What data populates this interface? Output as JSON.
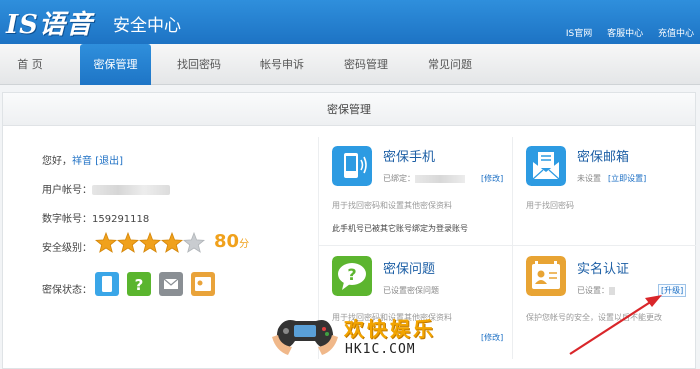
{
  "header": {
    "logo": "IS语音",
    "title": "安全中心",
    "links": [
      "IS官网",
      "客服中心",
      "充值中心"
    ]
  },
  "nav": {
    "items": [
      "首 页",
      "密保管理",
      "找回密码",
      "帐号申诉",
      "密码管理",
      "常见问题"
    ],
    "active_index": 1
  },
  "panel": {
    "title": "密保管理"
  },
  "account": {
    "greeting": "您好，",
    "username": "祥音",
    "logout": "[退出]",
    "user_label": "用户帐号：",
    "number_label": "数字帐号：",
    "number_value": "159291118",
    "level_label": "安全级别：",
    "stars": 4,
    "stars_max": 5,
    "score": "80",
    "score_unit": "分",
    "status_label": "密保状态："
  },
  "cards": {
    "phone": {
      "title": "密保手机",
      "status": "已绑定：",
      "action": "[修改]",
      "desc": "用于找回密码和设置其他密保资料",
      "note": "此手机号已被其它账号绑定为登录账号"
    },
    "email": {
      "title": "密保邮箱",
      "status": "未设置",
      "action": "[立即设置]",
      "desc": "用于找回密码"
    },
    "question": {
      "title": "密保问题",
      "status": "已设置密保问题",
      "action": "[修改]",
      "desc": "用于找回密码和设置其他密保资料"
    },
    "realname": {
      "title": "实名认证",
      "status": "已设置：",
      "action": "[升级]",
      "desc": "保护您帐号的安全，设置以后不能更改"
    }
  },
  "watermark": {
    "title": "欢快娱乐",
    "url": "HK1C.COM"
  },
  "colors": {
    "header_blue": "#1d73c4",
    "link_blue": "#1c6fc4",
    "star_gold": "#f0a11c",
    "arrow_red": "#d9262a"
  }
}
